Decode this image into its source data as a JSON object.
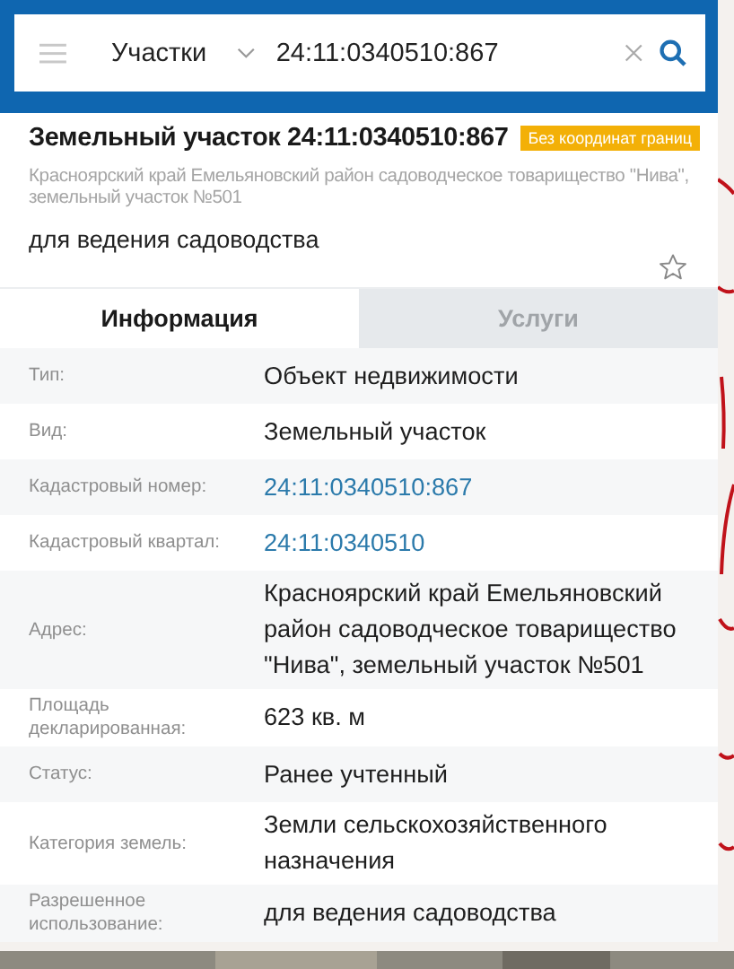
{
  "search": {
    "category": "Участки",
    "value": "24:11:0340510:867"
  },
  "object": {
    "title": "Земельный участок 24:11:0340510:867",
    "badge": "Без координат границ",
    "address": "Красноярский край Емельяновский район садоводческое товарищество \"Нива\", земельный участок №501",
    "purpose": "для ведения садоводства"
  },
  "tabs": [
    {
      "label": "Информация",
      "selected": true
    },
    {
      "label": "Услуги",
      "selected": false
    }
  ],
  "rows": [
    {
      "label": "Тип:",
      "value": "Объект недвижимости",
      "kind": "text"
    },
    {
      "label": "Вид:",
      "value": "Земельный участок",
      "kind": "text"
    },
    {
      "label": "Кадастровый номер:",
      "value": "24:11:0340510:867",
      "kind": "link"
    },
    {
      "label": "Кадастровый квартал:",
      "value": "24:11:0340510",
      "kind": "link"
    },
    {
      "label": "Адрес:",
      "value": "Красноярский край Емельяновский район садоводческое товарищество \"Нива\", земельный участок №501",
      "kind": "text"
    },
    {
      "label": "Площадь декларированная:",
      "value": "623 кв. м",
      "kind": "text"
    },
    {
      "label": "Статус:",
      "value": "Ранее учтенный",
      "kind": "text"
    },
    {
      "label": "Категория земель:",
      "value": "Земли сельскохозяйственного назначения",
      "kind": "text"
    },
    {
      "label": "Разрешенное использование:",
      "value": "для ведения садоводства",
      "kind": "text"
    }
  ]
}
